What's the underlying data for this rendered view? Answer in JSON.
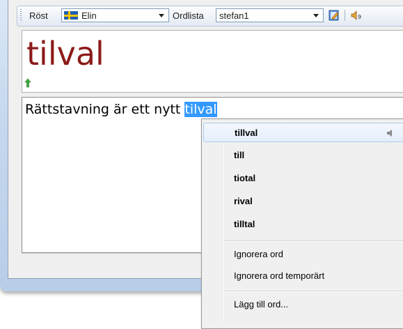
{
  "toolbar": {
    "voice_label": "Röst",
    "voice_value": "Elin",
    "wordlist_label": "Ordlista",
    "wordlist_value": "stefan1",
    "icons": [
      "swedish-flag-icon",
      "edit-list-icon",
      "speaker-settings-icon"
    ]
  },
  "display": {
    "current_word": "tilval"
  },
  "editor": {
    "text_before": "Rättstavning är ett nytt ",
    "selected_word": "tilval"
  },
  "context_menu": {
    "suggestions": [
      {
        "label": "tillval"
      },
      {
        "label": "till"
      },
      {
        "label": "tiotal"
      },
      {
        "label": "rival"
      },
      {
        "label": "tilltal"
      }
    ],
    "actions": [
      {
        "label": "Ignorera ord"
      },
      {
        "label": "Ignorera ord temporärt"
      },
      {
        "label": "Lägg till ord..."
      }
    ]
  },
  "colors": {
    "word_color": "#8b1a1a",
    "selection": "#3399ff"
  }
}
